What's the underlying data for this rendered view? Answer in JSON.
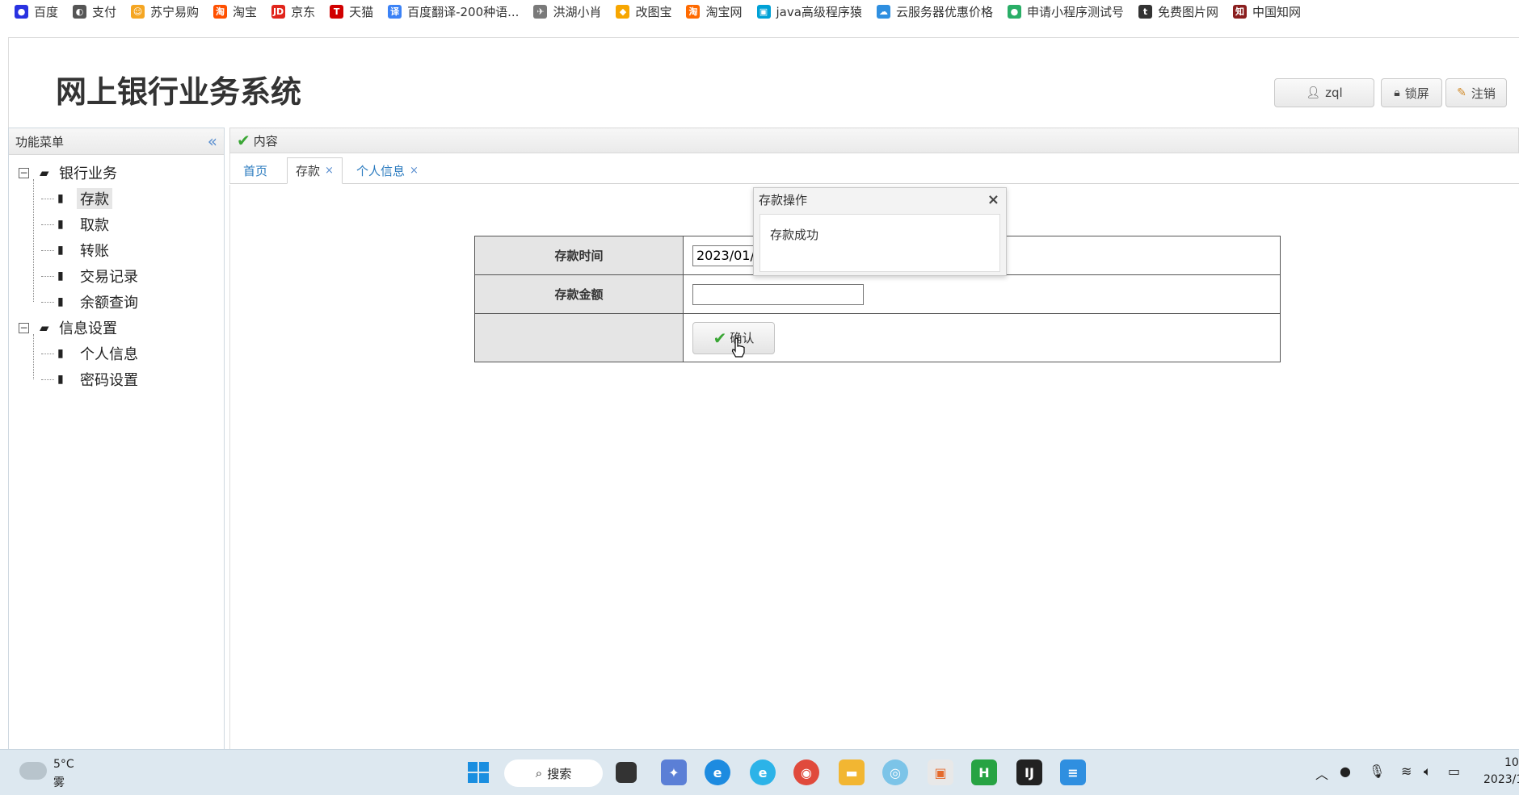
{
  "bookmarks": [
    {
      "label": "百度",
      "icon": "baidu-icon",
      "color": "#2932e1",
      "glyph": "●"
    },
    {
      "label": "支付",
      "icon": "globe-icon",
      "color": "#555555",
      "glyph": "◐"
    },
    {
      "label": "苏宁易购",
      "icon": "suning-icon",
      "color": "#f5a623",
      "glyph": "☺"
    },
    {
      "label": "淘宝",
      "icon": "taobao-icon",
      "color": "#ff5000",
      "glyph": "淘"
    },
    {
      "label": "京东",
      "icon": "jd-icon",
      "color": "#e1251b",
      "glyph": "JD"
    },
    {
      "label": "天猫",
      "icon": "tmall-icon",
      "color": "#d10000",
      "glyph": "T"
    },
    {
      "label": "百度翻译-200种语...",
      "icon": "translate-icon",
      "color": "#3b82f6",
      "glyph": "译"
    },
    {
      "label": "洪湖小肖",
      "icon": "bird-icon",
      "color": "#7a7a7a",
      "glyph": "✈"
    },
    {
      "label": "改图宝",
      "icon": "gaitubao-icon",
      "color": "#f7a600",
      "glyph": "◆"
    },
    {
      "label": "淘宝网",
      "icon": "taobao-net-icon",
      "color": "#ff6a00",
      "glyph": "淘"
    },
    {
      "label": "java高级程序猿",
      "icon": "bilibili-icon",
      "color": "#00a1d6",
      "glyph": "▣"
    },
    {
      "label": "云服务器优惠价格",
      "icon": "cloud-icon",
      "color": "#2f8fe0",
      "glyph": "☁"
    },
    {
      "label": "申请小程序测试号",
      "icon": "wechat-icon",
      "color": "#2aae67",
      "glyph": "●"
    },
    {
      "label": "免费图片网",
      "icon": "t-icon",
      "color": "#333333",
      "glyph": "t"
    },
    {
      "label": "中国知网",
      "icon": "cnki-icon",
      "color": "#8a1e1e",
      "glyph": "知"
    }
  ],
  "header": {
    "title": "网上银行业务系统",
    "user_label": "zql",
    "lock_label": "锁屏",
    "logout_label": "注销"
  },
  "sidebar": {
    "title": "功能菜单",
    "collapse_glyph": "«",
    "groups": [
      {
        "label": "银行业务",
        "toggle": "−",
        "items": [
          "存款",
          "取款",
          "转账",
          "交易记录",
          "余额查询"
        ]
      },
      {
        "label": "信息设置",
        "toggle": "−",
        "items": [
          "个人信息",
          "密码设置"
        ]
      }
    ]
  },
  "main": {
    "panel_title": "内容",
    "tabs": [
      {
        "label": "首页"
      },
      {
        "label": "存款",
        "close": "×"
      },
      {
        "label": "个人信息",
        "close": "×"
      }
    ]
  },
  "form": {
    "time_label": "存款时间",
    "time_value": "2023/01/",
    "amount_label": "存款金额",
    "amount_value": "",
    "confirm_label": "确认"
  },
  "dialog": {
    "title": "存款操作",
    "close": "×",
    "message": "存款成功"
  },
  "taskbar": {
    "temperature": "5°C",
    "weather": "雾",
    "search_label": "搜索",
    "clock_time": "10:",
    "clock_date": "2023/1"
  },
  "colors": {
    "accent": "#2b7bbf",
    "success": "#3aa635",
    "taskbar_bg": "#dde8f0"
  }
}
